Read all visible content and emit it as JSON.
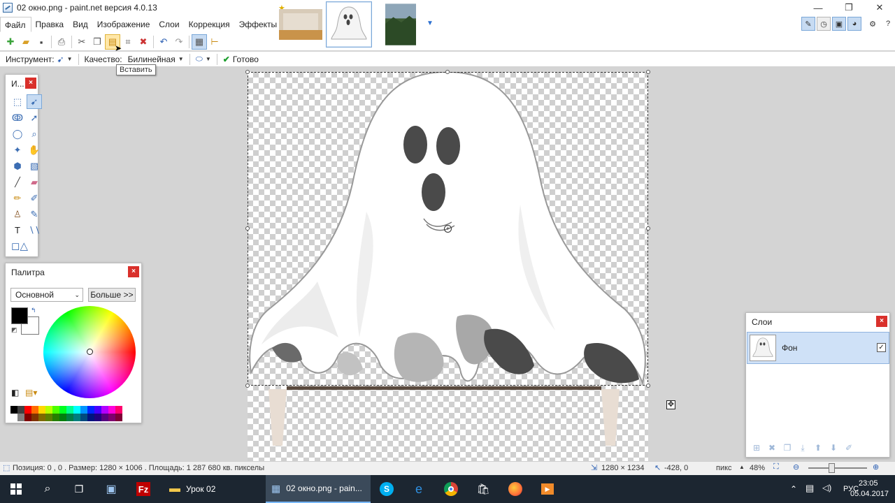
{
  "window": {
    "title": "02 окно.png - paint.net версия 4.0.13",
    "controls": [
      "—",
      "❐",
      "✕"
    ]
  },
  "menu": {
    "items": [
      "Файл",
      "Правка",
      "Вид",
      "Изображение",
      "Слои",
      "Коррекция",
      "Эффекты"
    ]
  },
  "tooltip": "Вставить",
  "options": {
    "tool_label": "Инструмент:",
    "quality_label": "Качество:",
    "quality_value": "Билинейная",
    "done_label": "Готово"
  },
  "tools_panel": {
    "title": "И...",
    "close": "×"
  },
  "palette_panel": {
    "title": "Палитра",
    "close": "×",
    "mode": "Основной",
    "more_button": "Больше >>",
    "colors_row1": [
      "#000000",
      "#404040",
      "#ff0000",
      "#ff6a00",
      "#ffd800",
      "#b6ff00",
      "#4cff00",
      "#00ff21",
      "#00ff90",
      "#00ffff",
      "#0094ff",
      "#0026ff",
      "#4800ff",
      "#b200ff",
      "#ff00dc",
      "#ff006e"
    ],
    "colors_row2": [
      "#ffffff",
      "#808080",
      "#7f0000",
      "#7f3300",
      "#7f6a00",
      "#5b7f00",
      "#267f00",
      "#007f0e",
      "#007f46",
      "#007f7f",
      "#004a7f",
      "#00137f",
      "#21007f",
      "#57007f",
      "#7f006e",
      "#7f0037"
    ]
  },
  "layers_panel": {
    "title": "Слои",
    "close": "×",
    "layer_name": "Фон",
    "visible_mark": "✓"
  },
  "status": {
    "info": "Позиция: 0 , 0 . Размер: 1280  × 1006 . Площадь: 1 287 680 кв. пикселы",
    "image_size": "1280 × 1234",
    "offset": "-428, 0",
    "units": "пикс",
    "zoom": "48%"
  },
  "taskbar": {
    "folder_label": "Урок 02",
    "active_app_label": "02 окно.png - pain...",
    "lang": "РУС",
    "time": "23:05",
    "date": "05.04.2017"
  },
  "colors": {
    "selection_blue": "#cfe1f7",
    "close_red": "#d9302b",
    "taskbar": "#1c2631"
  }
}
